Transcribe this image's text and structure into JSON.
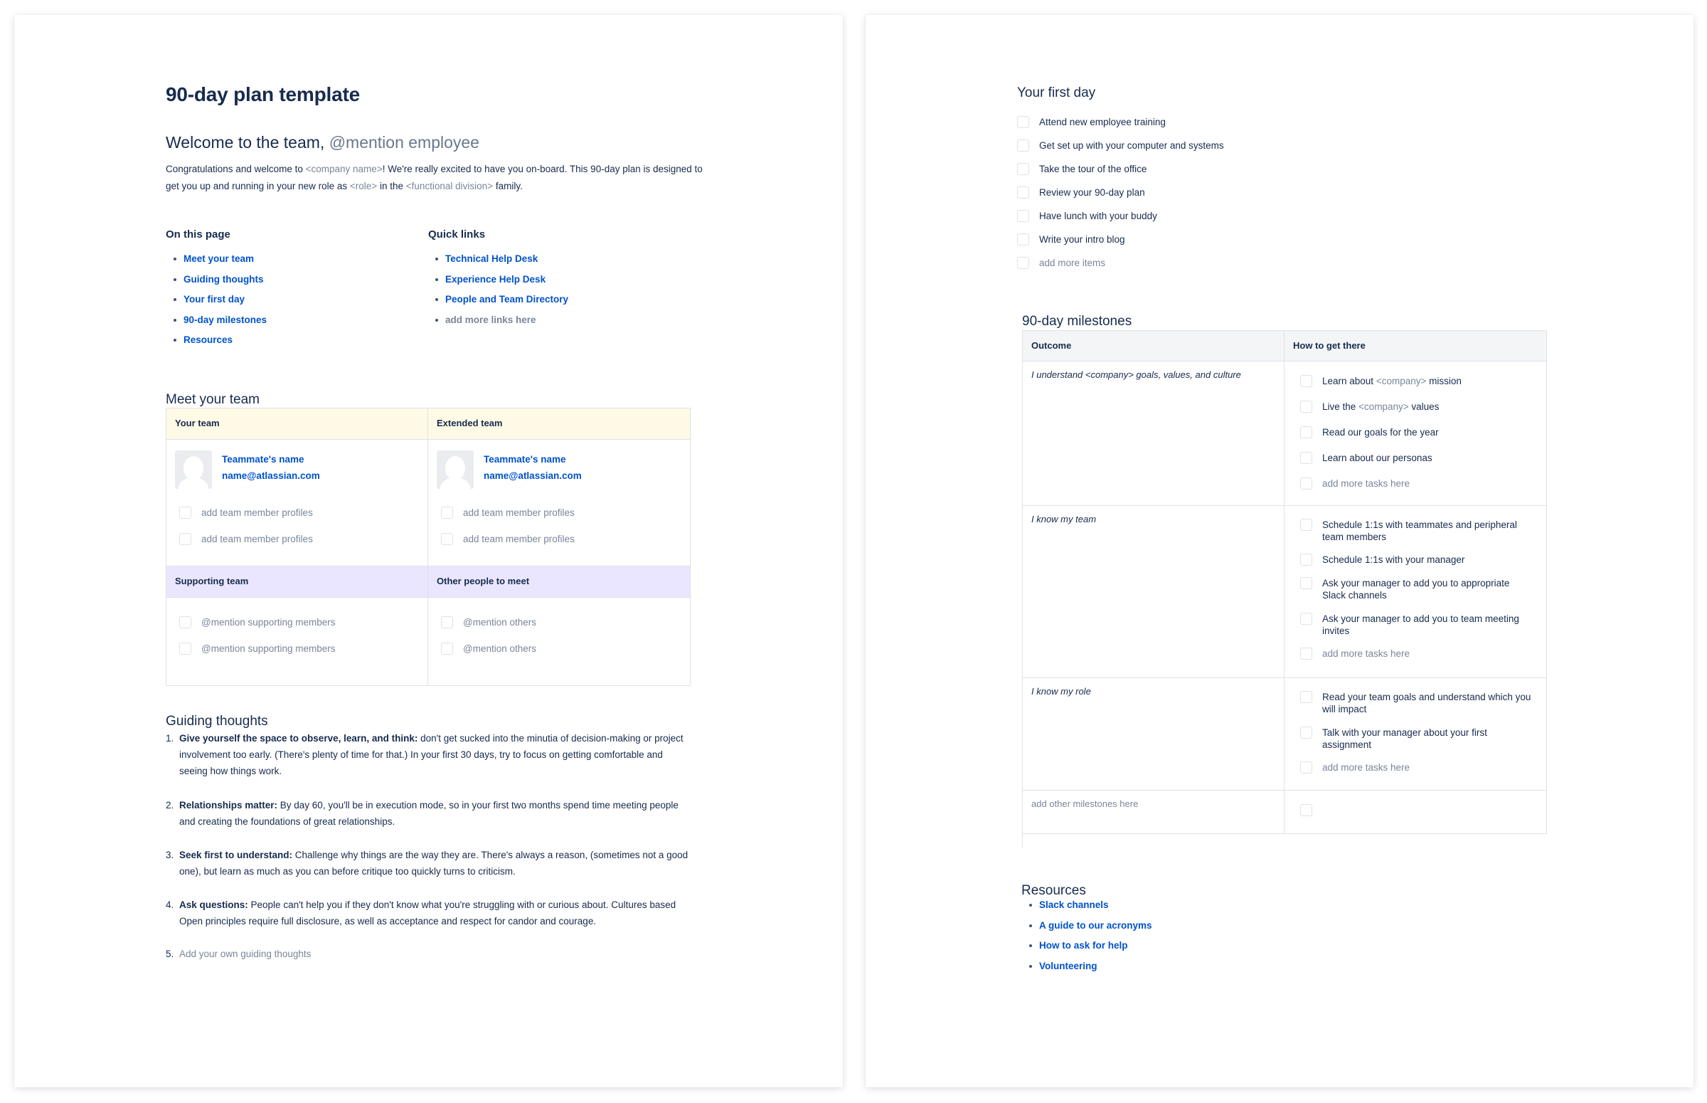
{
  "page1": {
    "title": "90-day plan template",
    "welcome": {
      "heading": "Welcome to the team,",
      "mention": "@mention employee"
    },
    "intro": {
      "part1": "Congratulations and welcome to ",
      "company_ph": "<company name>",
      "part2": "! We're really excited to have you on-board. This 90-day plan is designed to get you up and running in your new role as ",
      "role_ph": "<role>",
      "part3": " in the ",
      "division_ph": "<functional division>",
      "part4": " family."
    },
    "on_this_page": {
      "heading": "On this page",
      "links": [
        "Meet your team",
        "Guiding thoughts",
        "Your first day",
        "90-day milestones",
        "Resources"
      ]
    },
    "quick_links": {
      "heading": "Quick links",
      "links": [
        "Technical Help Desk",
        "Experience Help Desk",
        "People and Team Directory"
      ],
      "placeholder": "add more links here"
    },
    "meet_team": {
      "heading": "Meet your team",
      "colors": {
        "row1_header_bg": "#fffae6",
        "row2_header_bg": "#eae6ff",
        "border": "#dfe1e6"
      },
      "your_team": {
        "header": "Your team",
        "name": "Teammate's name",
        "email": "name@atlassian.com",
        "tasks": [
          "add team member profiles",
          "add team member profiles"
        ]
      },
      "extended_team": {
        "header": "Extended team",
        "name": "Teammate's name",
        "email": "name@atlassian.com",
        "tasks": [
          "add team member profiles",
          "add team member profiles"
        ]
      },
      "supporting_team": {
        "header": "Supporting team",
        "tasks": [
          "@mention supporting members",
          "@mention supporting members"
        ]
      },
      "other_people": {
        "header": "Other people to meet",
        "tasks": [
          "@mention others",
          "@mention others"
        ]
      }
    },
    "guiding_thoughts": {
      "heading": "Guiding thoughts",
      "items": [
        {
          "num": "1.",
          "bold": "Give yourself the space to observe, learn, and think:",
          "text": " don't get sucked into the minutia of decision-making or project involvement too early. (There's plenty of time for that.) In your first 30 days, try to focus on getting comfortable and seeing how things work."
        },
        {
          "num": "2.",
          "bold": "Relationships matter:",
          "text": " By day 60, you'll be in execution mode, so in your first two months spend time meeting people and creating the foundations of great relationships."
        },
        {
          "num": "3.",
          "bold": "Seek first to understand:",
          "text": " Challenge why things are the way they are. There's always a reason, (sometimes not a good one), but learn as much as you can before critique too quickly turns to criticism."
        },
        {
          "num": "4.",
          "bold": "Ask questions:",
          "text": " People can't help you if they don't know what you're struggling with or curious about. Cultures based Open principles require full disclosure, as well as acceptance and respect for candor and courage."
        }
      ],
      "placeholder": {
        "num": "5.",
        "text": "Add your own guiding thoughts"
      }
    }
  },
  "page2": {
    "first_day": {
      "heading": "Your first day",
      "items": [
        "Attend new employee training",
        "Get set up with your computer and systems",
        "Take the tour of the office",
        "Review your 90-day plan",
        "Have lunch with your buddy",
        "Write your intro blog"
      ],
      "placeholder": "add more items"
    },
    "milestones": {
      "heading": "90-day milestones",
      "header_bg": "#f4f5f7",
      "columns": [
        "Outcome",
        "How to get there"
      ],
      "rows": [
        {
          "outcome": "I understand <company> goals, values, and culture",
          "tasks": [
            {
              "pre": "Learn about ",
              "ph": "<company>",
              "post": " mission"
            },
            {
              "pre": "Live the ",
              "ph": "<company>",
              "post": " values"
            },
            {
              "pre": "Read our goals for the year",
              "ph": "",
              "post": ""
            },
            {
              "pre": "Learn about our personas",
              "ph": "",
              "post": ""
            }
          ],
          "placeholder": "add more tasks here"
        },
        {
          "outcome": "I know my team",
          "tasks": [
            "Schedule 1:1s with teammates and peripheral team members",
            "Schedule 1:1s with your manager",
            "Ask your manager to add you to appropriate Slack channels",
            "Ask your manager to add you to team meeting invites"
          ],
          "placeholder": "add more tasks here"
        },
        {
          "outcome": "I know my role",
          "tasks": [
            "Read your team goals and understand which you will impact",
            "Talk with your manager about your first assignment"
          ],
          "placeholder": "add more tasks here"
        },
        {
          "outcome_placeholder": "add other milestones here"
        }
      ]
    },
    "resources": {
      "heading": "Resources",
      "links": [
        "Slack channels",
        "A guide to our acronyms",
        "How to ask for help",
        "Volunteering"
      ]
    }
  },
  "colors": {
    "text": "#172b4d",
    "link": "#0052cc",
    "placeholder": "#7a869a"
  }
}
